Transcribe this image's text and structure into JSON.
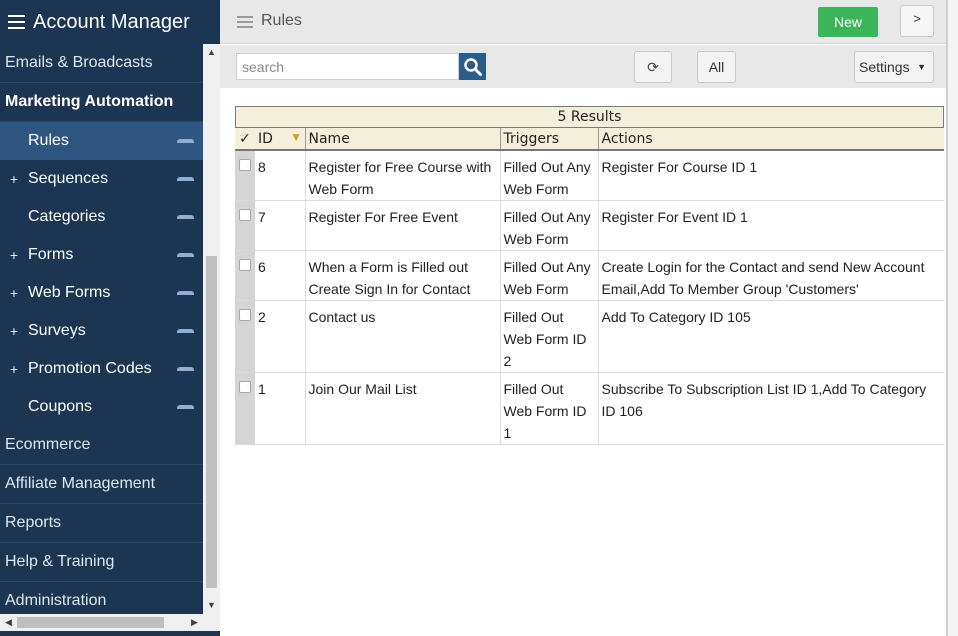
{
  "app": {
    "title": "Account Manager"
  },
  "sidebar": {
    "items": [
      {
        "label": "Emails & Broadcasts",
        "bold": false
      },
      {
        "label": "Marketing Automation",
        "bold": true
      }
    ],
    "subitems": [
      {
        "label": "Rules",
        "plus": "",
        "active": true
      },
      {
        "label": "Sequences",
        "plus": "+",
        "active": false
      },
      {
        "label": "Categories",
        "plus": "",
        "active": false
      },
      {
        "label": "Forms",
        "plus": "+",
        "active": false
      },
      {
        "label": "Web Forms",
        "plus": "+",
        "active": false
      },
      {
        "label": "Surveys",
        "plus": "+",
        "active": false
      },
      {
        "label": "Promotion Codes",
        "plus": "+",
        "active": false
      },
      {
        "label": "Coupons",
        "plus": "",
        "active": false
      }
    ],
    "bottom_items": [
      {
        "label": "Ecommerce"
      },
      {
        "label": "Affiliate Management"
      },
      {
        "label": "Reports"
      },
      {
        "label": "Help & Training"
      },
      {
        "label": "Administration"
      }
    ]
  },
  "header": {
    "title": "Rules",
    "new_label": "New",
    "expand_label": ">"
  },
  "toolbar": {
    "search_placeholder": "search",
    "refresh_label": "⟳",
    "all_label": "All",
    "settings_label": "Settings",
    "settings_caret": "▼"
  },
  "table": {
    "results_label": "5 Results",
    "check_header": "✓",
    "sort_indicator": "▼",
    "columns": [
      "ID",
      "Name",
      "Triggers",
      "Actions"
    ],
    "rows": [
      {
        "id": "8",
        "name": "Register for Free Course with Web Form",
        "triggers": "Filled Out Any Web Form",
        "actions": "Register For Course ID 1"
      },
      {
        "id": "7",
        "name": "Register For Free Event",
        "triggers": "Filled Out Any Web Form",
        "actions": "Register For Event ID 1"
      },
      {
        "id": "6",
        "name": "When a Form is Filled out Create Sign In for Contact",
        "triggers": "Filled Out Any Web Form",
        "actions": "Create Login for the Contact and send New Account Email,Add To Member Group 'Customers'"
      },
      {
        "id": "2",
        "name": "Contact us",
        "triggers": "Filled Out Web Form ID 2",
        "actions": "Add To Category ID 105"
      },
      {
        "id": "1",
        "name": "Join Our Mail List",
        "triggers": "Filled Out Web Form ID 1",
        "actions": "Subscribe To Subscription List ID 1,Add To Category ID 106"
      }
    ]
  },
  "colors": {
    "sidebar_bg": "#1b3553",
    "active_bg": "#2f5680",
    "new_button": "#3cb55a",
    "search_button": "#2b5d8b",
    "header_bg": "#f3efdb"
  }
}
